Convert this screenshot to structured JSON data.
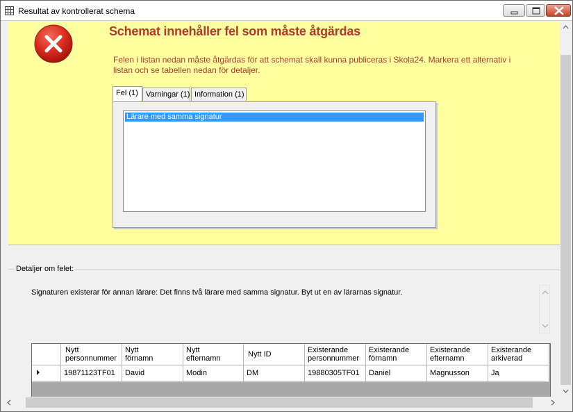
{
  "window": {
    "title": "Resultat av kontrollerat schema"
  },
  "banner": {
    "heading": "Schemat innehåller fel som måste åtgärdas",
    "description": "Felen i listan nedan måste åtgärdas för att schemat skall kunna publiceras i Skola24. Markera ett alternativ i listan och se tabellen nedan för detaljer."
  },
  "tabs": [
    {
      "label": "Fel (1)"
    },
    {
      "label": "Varningar (1)"
    },
    {
      "label": "Information (1)"
    }
  ],
  "list": {
    "items": [
      "Lärare med samma signatur"
    ]
  },
  "details": {
    "legend": "Detaljer om felet:",
    "text": "Signaturen existerar för annan lärare: Det finns två lärare med samma signatur. Byt ut en av lärarnas signatur."
  },
  "grid": {
    "headers": [
      {
        "l1": "Nytt",
        "l2": "personnummer"
      },
      {
        "l1": "Nytt",
        "l2": "förnamn"
      },
      {
        "l1": "Nytt",
        "l2": "efternamn"
      },
      {
        "l1": "Nytt ID",
        "l2": ""
      },
      {
        "l1": "Existerande",
        "l2": "personnummer"
      },
      {
        "l1": "Existerande",
        "l2": "förnamn"
      },
      {
        "l1": "Existerande",
        "l2": "efternamn"
      },
      {
        "l1": "Existerande",
        "l2": "arkiverad"
      }
    ],
    "rows": [
      [
        "19871123TF01",
        "David",
        "Modin",
        "DM",
        "19880305TF01",
        "Daniel",
        "Magnusson",
        "Ja"
      ]
    ]
  },
  "colors": {
    "heading": "#b03a2e",
    "banner_bg": "#ffffa0",
    "selection": "#3399ff"
  }
}
